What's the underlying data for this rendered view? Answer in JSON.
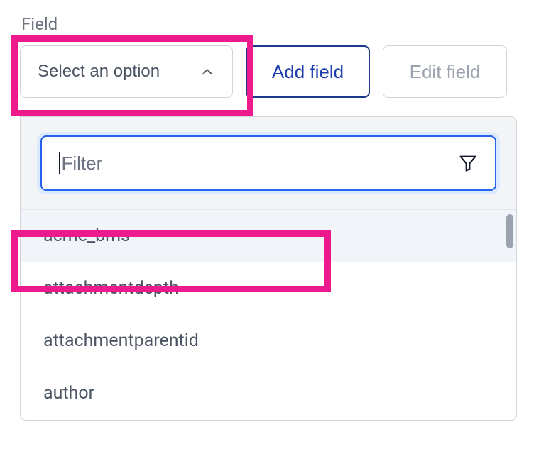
{
  "label": "Field",
  "select": {
    "placeholder": "Select an option"
  },
  "buttons": {
    "add": "Add field",
    "edit": "Edit field"
  },
  "filter": {
    "placeholder": "Filter",
    "value": ""
  },
  "options": [
    "acme_bms",
    "attachmentdepth",
    "attachmentparentid",
    "author"
  ],
  "highlighted_index": 0
}
